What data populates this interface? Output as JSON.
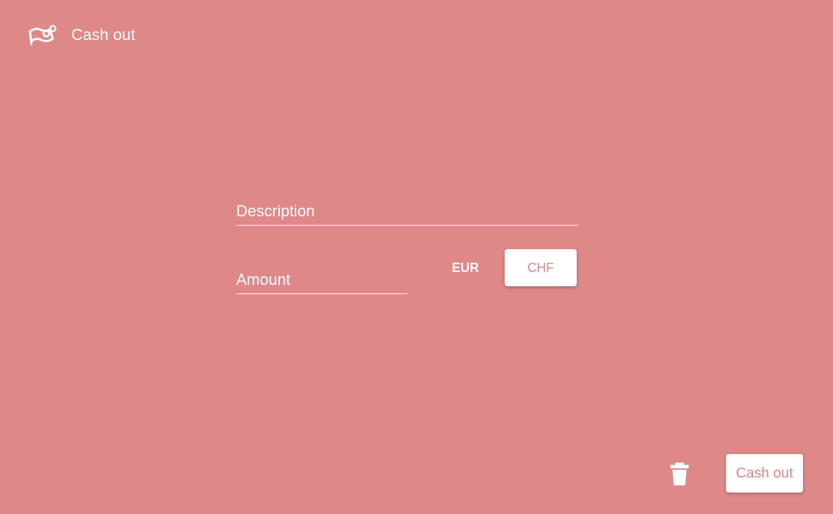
{
  "header": {
    "title": "Cash out",
    "icon": "flag-map-icon"
  },
  "form": {
    "description_placeholder": "Description",
    "description_value": "",
    "amount_placeholder": "Amount",
    "amount_value": "",
    "currency_options": [
      "EUR",
      "CHF"
    ],
    "currency_selected": "CHF"
  },
  "actions": {
    "delete_icon": "trash-icon",
    "submit_label": "Cash out"
  },
  "colors": {
    "background": "#de8888",
    "accent_text": "#de8888",
    "foreground": "#ffffff"
  }
}
